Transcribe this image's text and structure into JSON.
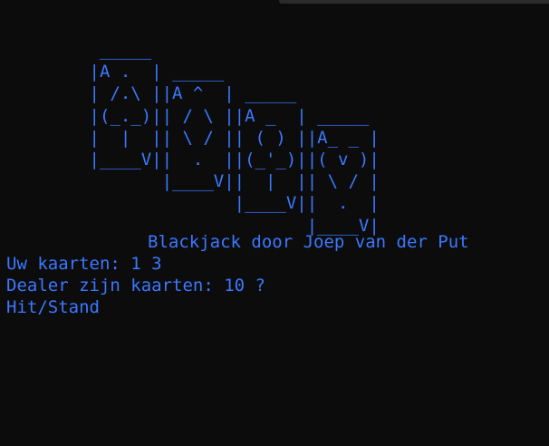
{
  "terminal": {
    "ascii_art": [
      "         _____",
      "        |A .  | _____",
      "        | /.\\ ||A ^  | _____",
      "        |(_._)|| / \\ ||A _  | _____",
      "        |  |  || \\ / || ( ) ||A_ _ |",
      "        |____V||  .  ||(_'_)||( v )|",
      "               |____V||  |  || \\ / |",
      "                      |____V||  .  |",
      "                             |____V|"
    ],
    "title": "Blackjack door Joep van der Put",
    "player_cards": "Uw kaarten: 1 3",
    "dealer_cards": "Dealer zijn kaarten: 10 ?",
    "prompt": "Hit/Stand"
  },
  "colors": {
    "background": "#0c0c0c",
    "text": "#3b78ff"
  }
}
